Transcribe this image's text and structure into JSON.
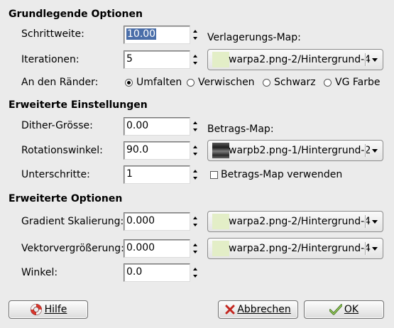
{
  "sections": {
    "basic": "Grundlegende Optionen",
    "advanced_settings": "Erweiterte Einstellungen",
    "advanced_options": "Erweiterte Optionen"
  },
  "basic": {
    "step_label": "Schrittweite:",
    "step_value": "10.00",
    "iter_label": "Iterationen:",
    "iter_value": "5",
    "edges_label": "An den Ränder:",
    "edge_options": [
      "Umfalten",
      "Verwischen",
      "Schwarz",
      "VG Farbe"
    ],
    "edge_selected": "Umfalten",
    "map_label": "Verlagerungs-Map:",
    "map_value": "warpa2.png-2/Hintergrund-4"
  },
  "advanced_settings": {
    "dither_label": "Dither-Grösse:",
    "dither_value": "0.00",
    "rot_label": "Rotationswinkel:",
    "rot_value": "90.0",
    "sub_label": "Unterschritte:",
    "sub_value": "1",
    "mag_label": "Betrags-Map:",
    "mag_value": "warpb2.png-1/Hintergrund-2",
    "use_mag_label": "Betrags-Map verwenden",
    "use_mag_checked": false
  },
  "advanced_options": {
    "grad_label": "Gradient Skalierung:",
    "grad_value": "0.000",
    "grad_map": "warpa2.png-2/Hintergrund-4",
    "vec_label": "Vektorvergrößerung:",
    "vec_value": "0.000",
    "vec_map": "warpa2.png-2/Hintergrund-4",
    "angle_label": "Winkel:",
    "angle_value": "0.0"
  },
  "buttons": {
    "help": "Hilfe",
    "cancel": "Abbrechen",
    "ok": "OK"
  },
  "colors": {
    "swatch_light": "#e3eec7",
    "selection": "#4a6ea9"
  }
}
